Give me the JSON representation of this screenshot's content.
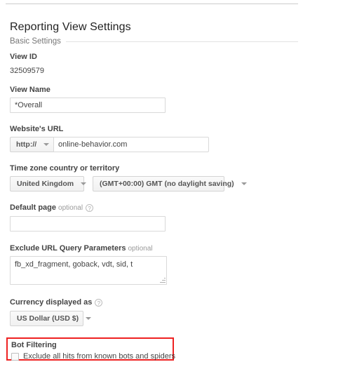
{
  "page": {
    "title": "Reporting View Settings",
    "section_label": "Basic Settings"
  },
  "fields": {
    "view_id": {
      "label": "View ID",
      "value": "32509579"
    },
    "view_name": {
      "label": "View Name",
      "value": "*Overall",
      "placeholder": ""
    },
    "website_url": {
      "label": "Website's URL",
      "scheme": "http://",
      "value": "online-behavior.com",
      "placeholder": ""
    },
    "time_zone": {
      "label": "Time zone country or territory",
      "country": "United Kingdom",
      "zone": "(GMT+00:00) GMT (no daylight saving)"
    },
    "default_page": {
      "label": "Default page",
      "optional": "optional",
      "help": "?",
      "value": "",
      "placeholder": ""
    },
    "exclude_query_params": {
      "label": "Exclude URL Query Parameters",
      "optional": "optional",
      "value": "fb_xd_fragment, goback, vdt, sid, t",
      "placeholder": ""
    },
    "currency": {
      "label": "Currency displayed as",
      "help": "?",
      "value": "US Dollar (USD $)"
    },
    "bot_filtering": {
      "label": "Bot Filtering",
      "checkbox_label": "Exclude all hits from known bots and spiders",
      "checked": false
    }
  },
  "colors": {
    "highlight": "#ee2222",
    "label_text": "#444444",
    "muted_text": "#999999",
    "border": "#d9d9d9"
  }
}
